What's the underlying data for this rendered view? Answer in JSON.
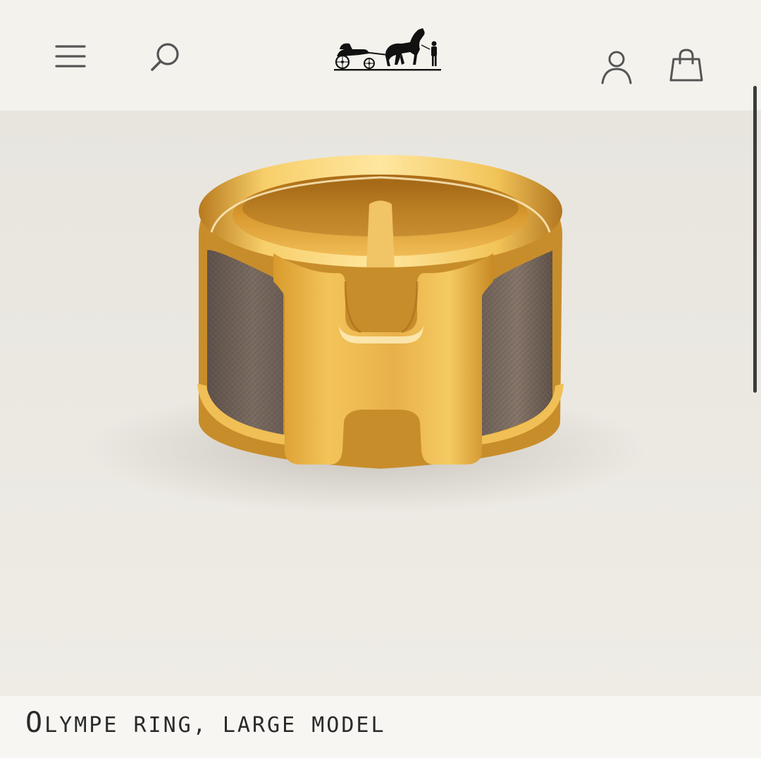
{
  "header": {
    "menu_icon": "hamburger-menu-icon",
    "search_icon": "search-icon",
    "logo": "hermes-carriage-logo",
    "account_icon": "account-icon",
    "bag_icon": "shopping-bag-icon"
  },
  "product": {
    "title": "Olympe ring, large model",
    "image": "gold-h-ring-with-taupe-leather"
  },
  "colors": {
    "header_bg": "#f4f2ed",
    "gold": "#e0a83d",
    "leather": "#6f6158",
    "text": "#2a2a2a"
  }
}
